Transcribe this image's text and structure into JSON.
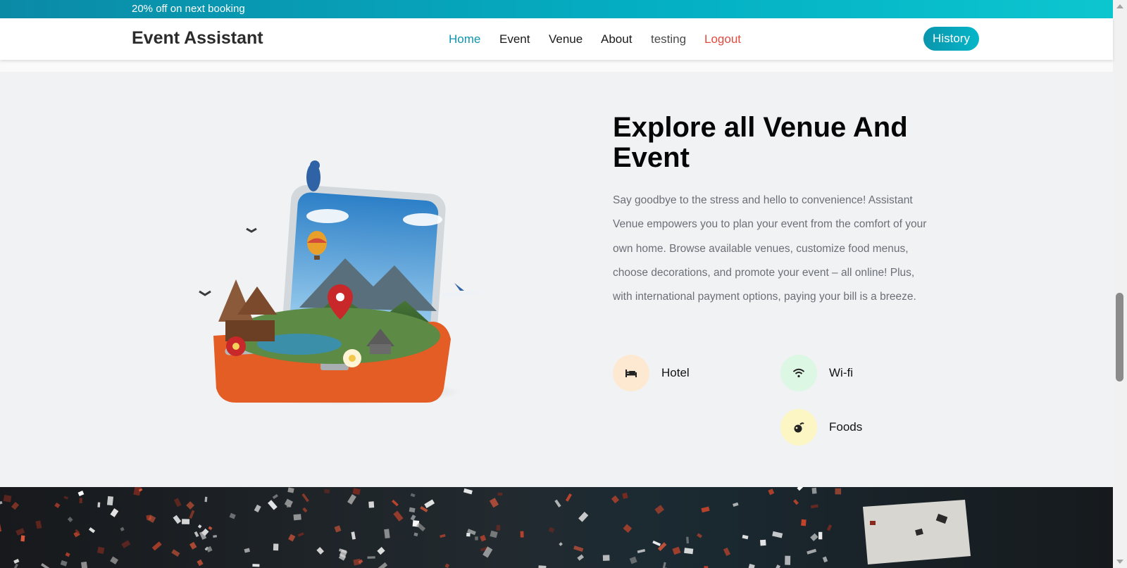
{
  "promo_bar": {
    "text": "20% off on next booking"
  },
  "navbar": {
    "brand": "Event Assistant",
    "links": [
      {
        "label": "Home",
        "state": "active"
      },
      {
        "label": "Event"
      },
      {
        "label": "Venue"
      },
      {
        "label": "About"
      },
      {
        "label": "testing"
      },
      {
        "label": "Logout"
      }
    ],
    "history_button": "History"
  },
  "about_section": {
    "title": "Explore all Venue And Event",
    "description": "Say goodbye to the stress and hello to convenience! Assistant Venue empowers you to plan your event from the comfort of your own home. Browse available venues, customize food menus, choose decorations, and promote your event – all online! Plus, with international payment options, paying your bill is a breeze.",
    "features": [
      {
        "label": "Hotel",
        "icon": "bed-icon",
        "icon_bg": "#fde9d2"
      },
      {
        "label": "Wi-fi",
        "icon": "wifi-icon",
        "icon_bg": "#dcf7e4"
      },
      {
        "label": "Foods",
        "icon": "food-icon",
        "icon_bg": "#fbf6c4"
      }
    ],
    "hero_image": "suitcase-landscape-illustration"
  },
  "colors": {
    "accent": "#1293ad",
    "logout": "#e04a3f",
    "section_bg": "#f1f2f4",
    "body_text": "#6b6f76"
  }
}
